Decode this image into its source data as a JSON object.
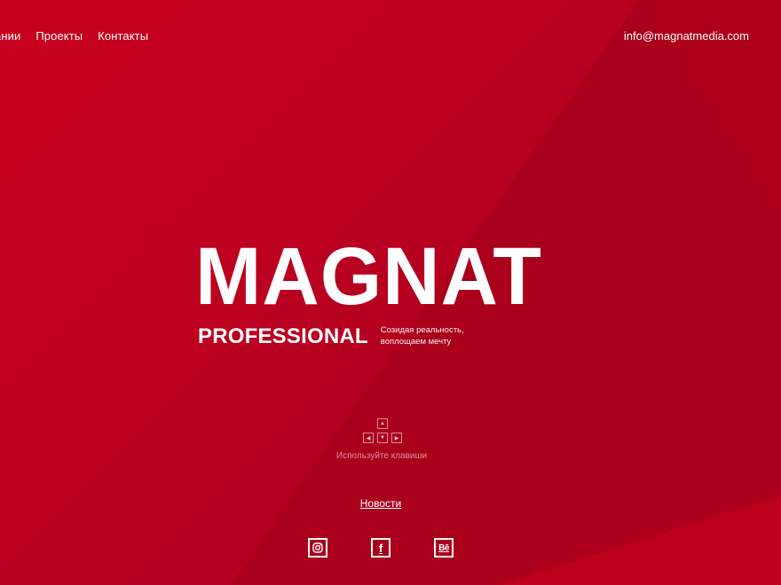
{
  "nav": {
    "items": [
      {
        "label": "ании"
      },
      {
        "label": "Проекты"
      },
      {
        "label": "Контакты"
      }
    ],
    "email": "info@magnatmedia.com"
  },
  "hero": {
    "title": "MAGNAT",
    "subtitle": "PROFESSIONAL",
    "tagline": "Созидая реальность, воплощаем мечту"
  },
  "keyboard": {
    "hint": "Используйте клавиши",
    "keys": [
      "arrow-up",
      "arrow-left",
      "arrow-down",
      "arrow-right"
    ]
  },
  "news": {
    "label": "Новости"
  },
  "social": {
    "items": [
      {
        "icon": "instagram-icon"
      },
      {
        "icon": "facebook-icon"
      },
      {
        "icon": "behance-icon"
      }
    ],
    "fb_glyph": "f",
    "be_glyph": "Bē"
  },
  "colors": {
    "background": "#c0001f",
    "text": "#ffffff"
  }
}
